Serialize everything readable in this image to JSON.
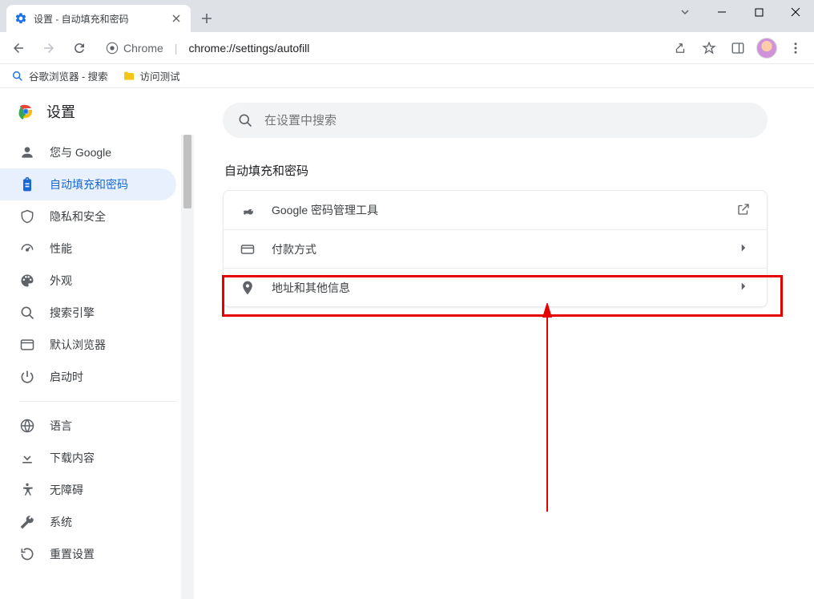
{
  "window": {
    "tab_title": "设置 - 自动填充和密码"
  },
  "omnibox": {
    "host_label": "Chrome",
    "url": "chrome://settings/autofill"
  },
  "bookmarks": [
    {
      "label": "谷歌浏览器 - 搜索",
      "icon": "search",
      "color": "#1a73e8"
    },
    {
      "label": "访问测试",
      "icon": "folder",
      "color": "#f5c518"
    }
  ],
  "settings": {
    "title": "设置",
    "search_placeholder": "在设置中搜索",
    "nav_group1": [
      {
        "id": "you-and-google",
        "label": "您与 Google",
        "icon": "person"
      },
      {
        "id": "autofill",
        "label": "自动填充和密码",
        "icon": "clipboard",
        "active": true
      },
      {
        "id": "privacy",
        "label": "隐私和安全",
        "icon": "shield"
      },
      {
        "id": "performance",
        "label": "性能",
        "icon": "speed"
      },
      {
        "id": "appearance",
        "label": "外观",
        "icon": "palette"
      },
      {
        "id": "search-engine",
        "label": "搜索引擎",
        "icon": "search"
      },
      {
        "id": "default-browser",
        "label": "默认浏览器",
        "icon": "browser"
      },
      {
        "id": "on-startup",
        "label": "启动时",
        "icon": "power"
      }
    ],
    "nav_group2": [
      {
        "id": "languages",
        "label": "语言",
        "icon": "globe"
      },
      {
        "id": "downloads",
        "label": "下载内容",
        "icon": "download"
      },
      {
        "id": "accessibility",
        "label": "无障碍",
        "icon": "accessibility"
      },
      {
        "id": "system",
        "label": "系统",
        "icon": "wrench"
      },
      {
        "id": "reset",
        "label": "重置设置",
        "icon": "reset"
      }
    ],
    "section_title": "自动填充和密码",
    "rows": [
      {
        "id": "password-manager",
        "label": "Google 密码管理工具",
        "icon": "key",
        "trailing": "open"
      },
      {
        "id": "payments",
        "label": "付款方式",
        "icon": "card",
        "trailing": "chevron"
      },
      {
        "id": "addresses",
        "label": "地址和其他信息",
        "icon": "pin",
        "trailing": "chevron"
      }
    ]
  }
}
